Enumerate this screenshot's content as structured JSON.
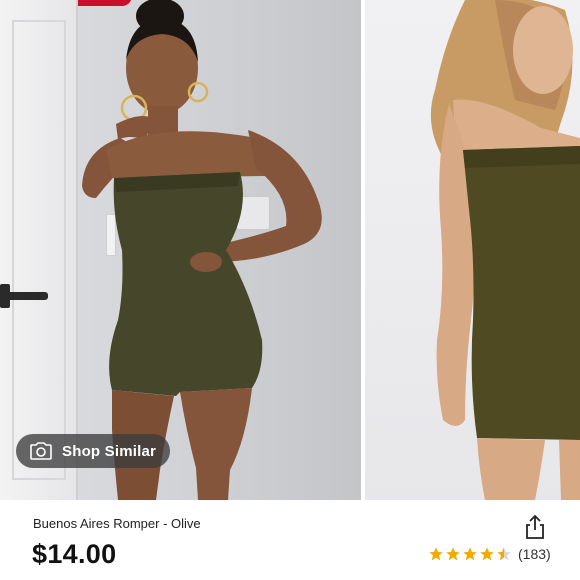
{
  "product": {
    "title": "Buenos Aires Romper - Olive",
    "price": "$14.00",
    "rating_stars": 4.5,
    "review_count": "(183)"
  },
  "gallery": {
    "shop_similar_label": "Shop Similar",
    "main_photo": "olive strapless romper front view",
    "side_photo": "olive strapless romper alternate view"
  },
  "colors": {
    "olive": "#4a4a2a",
    "star": "#f2a900",
    "badge": "#c8102e"
  },
  "icons": {
    "camera": "camera-icon",
    "share": "share-icon",
    "star": "star-icon"
  }
}
